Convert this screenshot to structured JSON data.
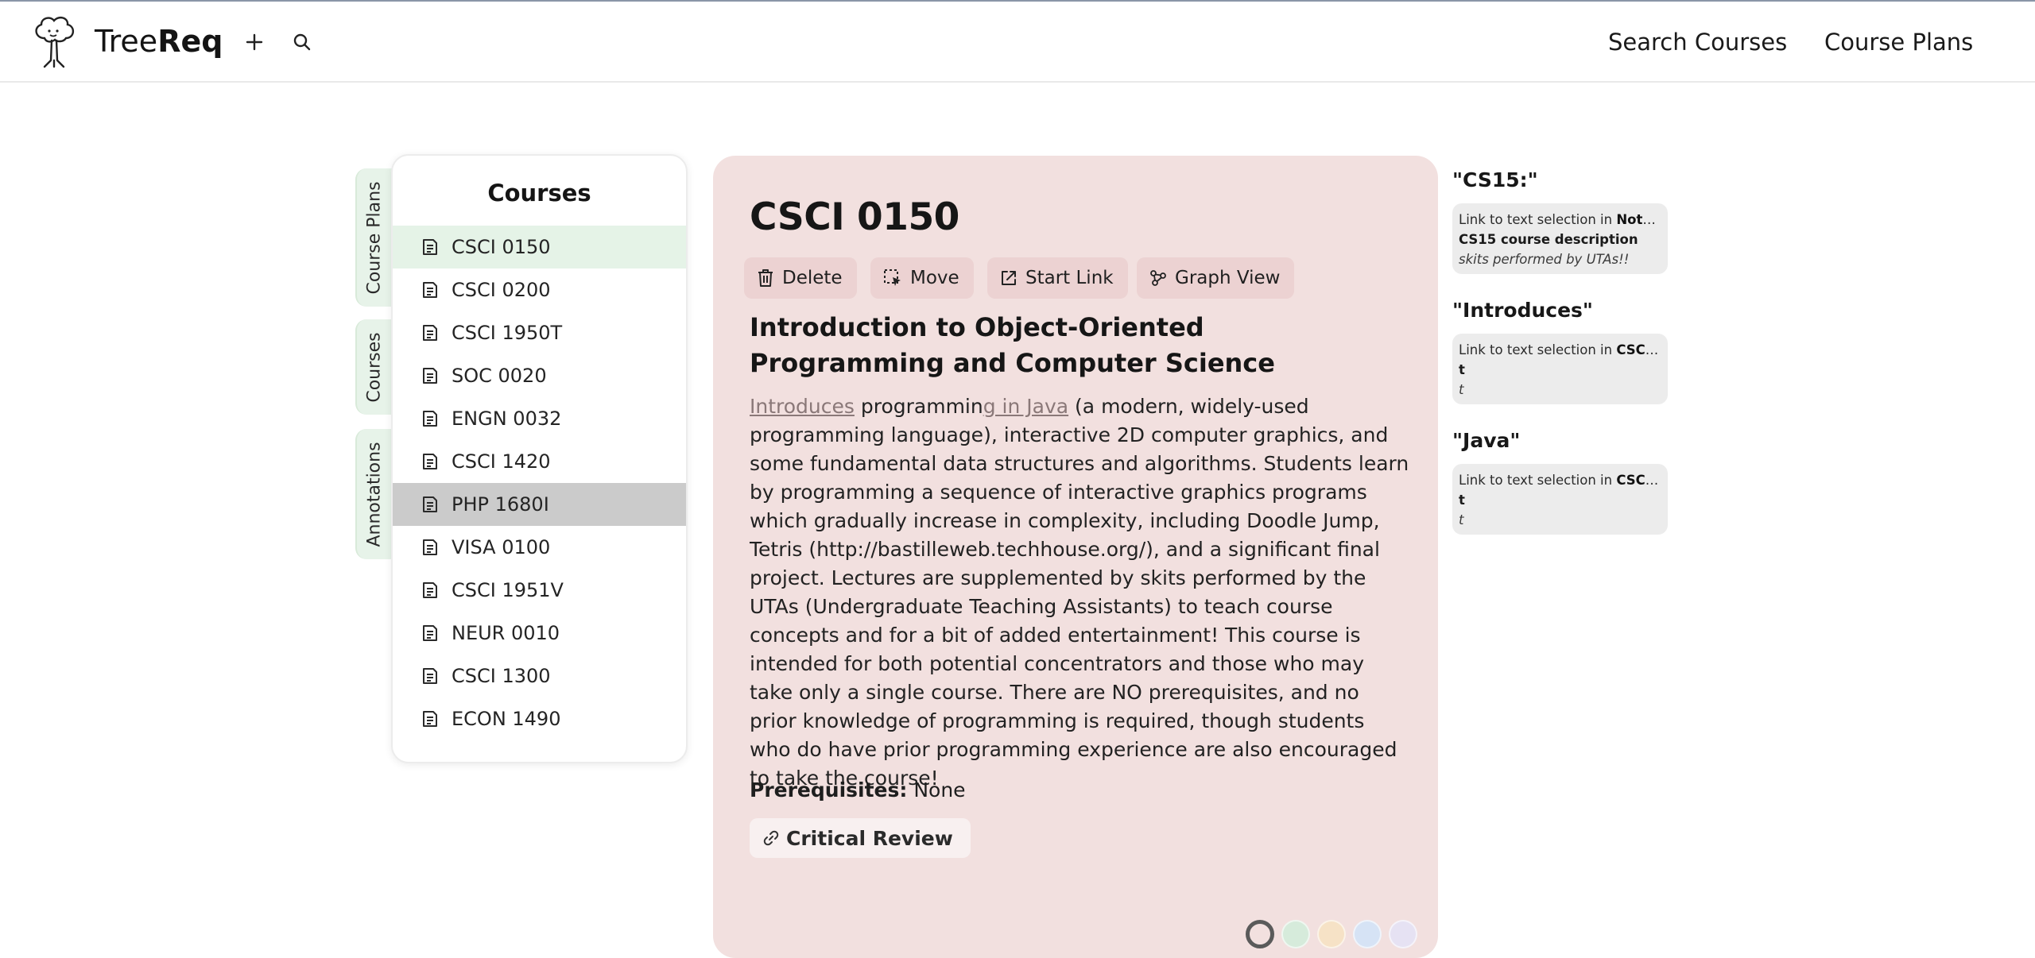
{
  "app": {
    "brand_light": "Tree",
    "brand_bold": "Req",
    "nav": [
      "Search Courses",
      "Course Plans"
    ]
  },
  "side_tabs": [
    "Course Plans",
    "Courses",
    "Annotations"
  ],
  "sidebar": {
    "title": "Courses",
    "items": [
      "CSCI 0150",
      "CSCI 0200",
      "CSCI 1950T",
      "SOC 0020",
      "ENGN 0032",
      "CSCI 1420",
      "PHP 1680I",
      "VISA 0100",
      "CSCI 1951V",
      "NEUR 0010",
      "CSCI 1300",
      "ECON 1490"
    ],
    "active": "CSCI 0150",
    "hovered": "PHP 1680I"
  },
  "course": {
    "code": "CSCI 0150",
    "actions": [
      "Delete",
      "Move",
      "Start Link",
      "Graph View"
    ],
    "title": "Introduction to Object-Oriented Programming and Computer Science",
    "desc_link1": "Introduces",
    "desc_part1": " programmin",
    "desc_link2": "g in Java",
    "desc_part2": " (a modern, widely-used programming language), interactive 2D computer graphics, and some fundamental data structures and algorithms. Students learn by programming a sequence of interactive graphics programs which gradually increase in complexity, including Doodle Jump, Tetris (http://bastilleweb.techhouse.org/), and a significant final project. Lectures are supplemented by skits performed by the UTAs (Undergraduate Teaching Assistants) to teach course concepts and for a bit of added entertainment! This course is intended for both potential concentrators and those who may take only a single course. There are NO prerequisites, and no prior knowledge of programming is required, though students who do have prior programming experience are also encouraged to take the course!",
    "prereq_label": "Prerequisites:",
    "prereq_value": "None",
    "review_label": "Critical Review",
    "swatch_colors": [
      "#f2e0df",
      "#d6ebdb",
      "#f6e2c6",
      "#d6e3f5",
      "#e6e2f3"
    ],
    "card_color": "#f2e0df"
  },
  "annotations": [
    {
      "title": "\"CS15:\"",
      "prefix": "Link to text selection in ",
      "target": "Notes ...",
      "bold": "CS15 course description",
      "italic": "skits performed by UTAs!!"
    },
    {
      "title": "\"Introduces\"",
      "prefix": "Link to text selection in ",
      "target": "CSCI ...",
      "bold": "t",
      "italic": "t"
    },
    {
      "title": "\"Java\"",
      "prefix": "Link to text selection in ",
      "target": "CSCI ...",
      "bold": "t",
      "italic": "t"
    }
  ]
}
